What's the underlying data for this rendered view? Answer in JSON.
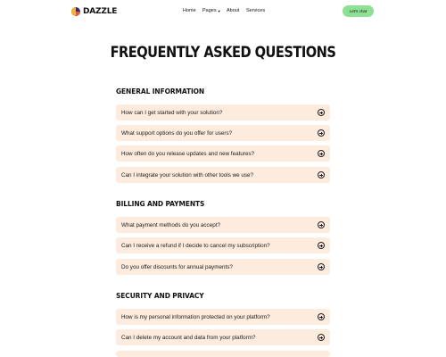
{
  "nav": {
    "brand": "DAZZLE",
    "links": [
      "Home",
      "Pages",
      "About",
      "Services"
    ],
    "cta": "Let's chat"
  },
  "page_title": "FREQUENTLY ASKED QUESTIONS",
  "sections": [
    {
      "title": "GENERAL INFORMATION",
      "questions": [
        "How can I get started with your solution?",
        "What support options do you offer for users?",
        "How often do you release updates and new features?",
        "Can I integrate your solution with other tools we use?"
      ]
    },
    {
      "title": "BILLING AND PAYMENTS",
      "questions": [
        "What payment methods do you accept?",
        "Can I receive a refund if I decide to cancel my subscription?",
        "Do you offer discounts for annual payments?"
      ]
    },
    {
      "title": "SECURITY AND PRIVACY",
      "questions": [
        "How is my personal information protected on your platform?",
        "Can I delete my account and data from your platform?"
      ]
    }
  ]
}
